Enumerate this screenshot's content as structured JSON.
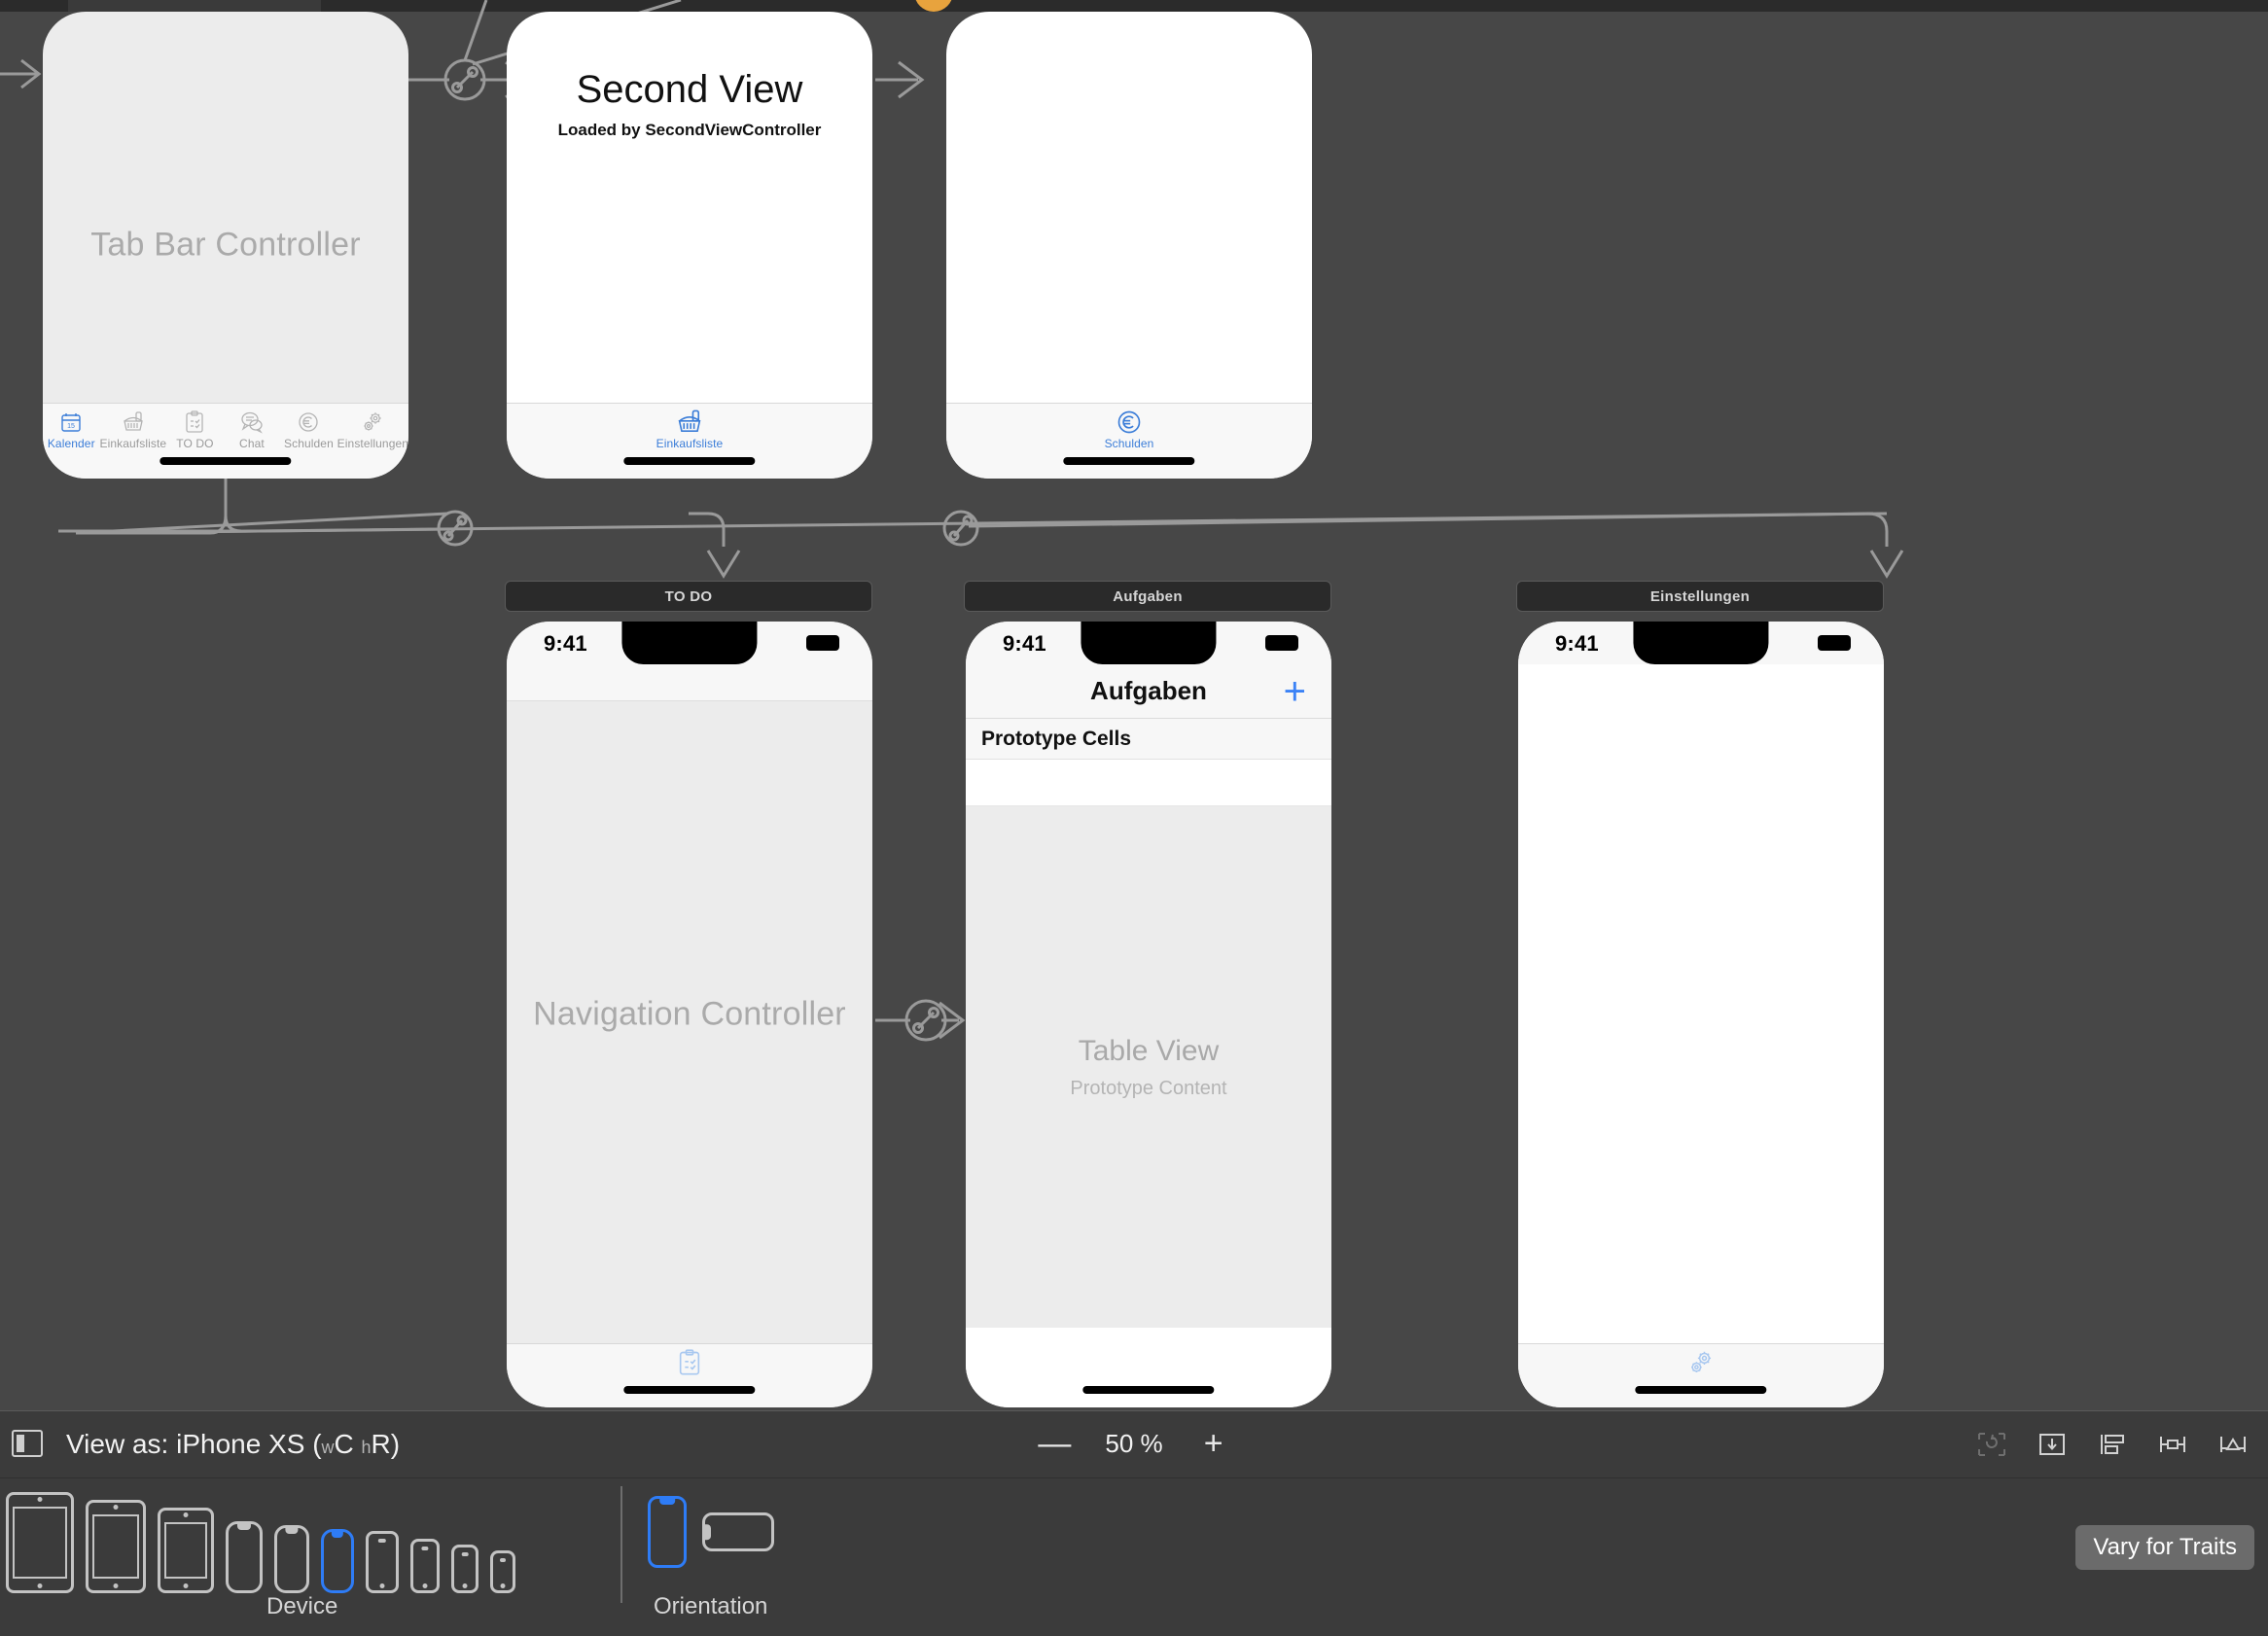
{
  "app": {
    "tool": "Xcode Interface Builder Storyboard Canvas"
  },
  "scenes": {
    "tab_bar_controller": {
      "label": "Tab Bar Controller",
      "tabs": [
        {
          "label": "Kalender",
          "icon": "calendar-icon",
          "selected": true
        },
        {
          "label": "Einkaufsliste",
          "icon": "basket-icon",
          "selected": false
        },
        {
          "label": "TO DO",
          "icon": "clipboard-icon",
          "selected": false
        },
        {
          "label": "Chat",
          "icon": "chat-icon",
          "selected": false
        },
        {
          "label": "Schulden",
          "icon": "euro-icon",
          "selected": false
        },
        {
          "label": "Einstellungen",
          "icon": "gears-icon",
          "selected": false
        }
      ]
    },
    "second_view": {
      "title": "Second View",
      "subtitle": "Loaded by SecondViewController",
      "tab": {
        "label": "Einkaufsliste",
        "icon": "basket-icon"
      }
    },
    "schulden_view": {
      "tab": {
        "label": "Schulden",
        "icon": "euro-icon"
      }
    },
    "todo_nav": {
      "scene_title": "TO DO",
      "controller_label": "Navigation Controller",
      "status_time": "9:41",
      "tab": {
        "icon": "clipboard-icon"
      }
    },
    "aufgaben_table": {
      "scene_title": "Aufgaben",
      "status_time": "9:41",
      "nav_title": "Aufgaben",
      "add_button": "+",
      "section_header": "Prototype Cells",
      "placeholder_title": "Table View",
      "placeholder_subtitle": "Prototype Content"
    },
    "einstellungen_view": {
      "scene_title": "Einstellungen",
      "status_time": "9:41",
      "tab": {
        "icon": "gears-icon"
      }
    }
  },
  "bottom_bar": {
    "panel_toggle_icon": "panel-toggle-icon",
    "view_as_prefix": "View as: iPhone XS (",
    "view_as_w": "w",
    "view_as_wclass": "C",
    "view_as_h": "h",
    "view_as_hclass": "R",
    "view_as_suffix": ")",
    "zoom_out": "—",
    "zoom_value": "50 %",
    "zoom_in": "+",
    "toolbar_icons": [
      "update-frames-icon",
      "embed-in-icon",
      "align-icon",
      "add-constraints-icon",
      "resolve-issues-icon"
    ],
    "device_label": "Device",
    "orientation_label": "Orientation",
    "vary_for_traits": "Vary for Traits",
    "devices": [
      {
        "name": "ipad-pro-12",
        "type": "ipad",
        "selected": false
      },
      {
        "name": "ipad-pro-11",
        "type": "ipad",
        "selected": false
      },
      {
        "name": "ipad-mini",
        "type": "ipad",
        "selected": false
      },
      {
        "name": "iphone-xs-max",
        "type": "iphone-notch",
        "selected": false
      },
      {
        "name": "iphone-xr",
        "type": "iphone-notch",
        "selected": false
      },
      {
        "name": "iphone-xs",
        "type": "iphone-notch",
        "selected": true
      },
      {
        "name": "iphone-8-plus",
        "type": "iphone-old",
        "selected": false
      },
      {
        "name": "iphone-8",
        "type": "iphone-old",
        "selected": false
      },
      {
        "name": "iphone-7",
        "type": "iphone-old",
        "selected": false
      },
      {
        "name": "iphone-se",
        "type": "iphone-old",
        "selected": false
      }
    ],
    "orientations": [
      {
        "name": "portrait",
        "selected": true
      },
      {
        "name": "landscape",
        "selected": false
      }
    ]
  },
  "colors": {
    "canvas_bg": "#474747",
    "panel_bg": "#3b3b3b",
    "accent_blue": "#2e7cf6",
    "tab_tint": "#3b7dd8",
    "scene_title_bg": "#2a2a2a"
  }
}
